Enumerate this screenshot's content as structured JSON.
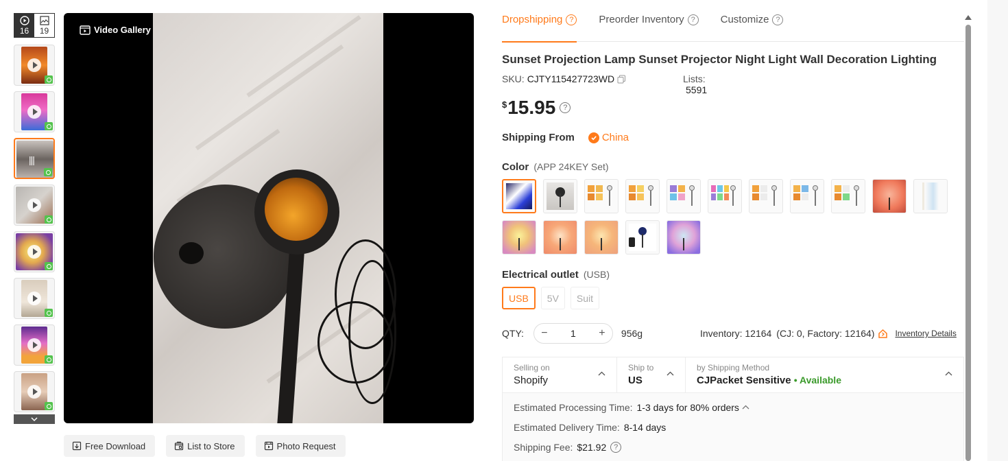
{
  "gallery": {
    "video_count": "16",
    "photo_count": "19",
    "video_gallery_label": "Video Gallery",
    "actions": {
      "free_download": "Free Download",
      "list_to_store": "List to Store",
      "photo_request": "Photo Request"
    },
    "thumbnails": [
      {
        "kind": "video",
        "tone": "orange-sunset",
        "active": false
      },
      {
        "kind": "video",
        "tone": "pink-magenta",
        "active": false
      },
      {
        "kind": "audio",
        "tone": "grey-blur",
        "active": true
      },
      {
        "kind": "video",
        "tone": "grey-fabric",
        "active": false
      },
      {
        "kind": "video",
        "tone": "yellow-glow",
        "active": false
      },
      {
        "kind": "video",
        "tone": "beige-room",
        "active": false
      },
      {
        "kind": "video",
        "tone": "purple-glow",
        "active": false
      },
      {
        "kind": "video",
        "tone": "person-portrait",
        "active": false
      }
    ]
  },
  "tabs": [
    {
      "label": "Dropshipping",
      "active": true
    },
    {
      "label": "Preorder Inventory",
      "active": false
    },
    {
      "label": "Customize",
      "active": false
    }
  ],
  "product": {
    "title": "Sunset Projection Lamp Sunset Projector Night Light Wall Decoration Lighting",
    "sku_label": "SKU:",
    "sku": "CJTY115427723WD",
    "lists_label": "Lists:",
    "lists": "5591",
    "currency": "$",
    "price": "15.95",
    "shipping_from_label": "Shipping From",
    "shipping_from": "China",
    "color_label": "Color",
    "color_selected": "(APP 24KEY Set)",
    "color_swatch_count": 16,
    "outlet_label": "Electrical outlet",
    "outlet_selected": "(USB)",
    "outlet_options": [
      "USB",
      "5V",
      "Suit"
    ],
    "qty_label": "QTY:",
    "qty": "1",
    "weight": "956g",
    "inventory": "Inventory: 12164",
    "inventory_breakdown": "(CJ: 0, Factory: 12164)",
    "inventory_link": "Inventory Details"
  },
  "shipping": {
    "selling_on_label": "Selling on",
    "selling_on": "Shopify",
    "ship_to_label": "Ship to",
    "ship_to": "US",
    "method_label": "by Shipping Method",
    "method": "CJPacket Sensitive",
    "availability": "• Available",
    "processing_label": "Estimated Processing Time:",
    "processing": "1-3 days for 80% orders",
    "delivery_label": "Estimated Delivery Time:",
    "delivery": "8-14 days",
    "fee_label": "Shipping Fee:",
    "fee": "$21.92"
  },
  "colors": {
    "accent": "#ff7a1a",
    "available": "#3a9a2a"
  }
}
